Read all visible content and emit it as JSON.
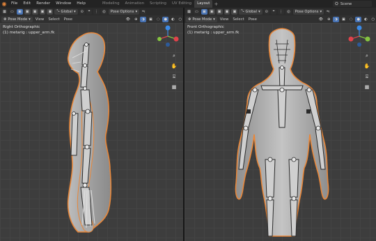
{
  "menu": {
    "items": [
      "File",
      "Edit",
      "Render",
      "Window",
      "Help"
    ],
    "workspaces": [
      "Modeling",
      "Animation",
      "Scripting",
      "UV Editing",
      "Layout"
    ],
    "active_workspace": "Layout",
    "scene_label": "Scene"
  },
  "left_view": {
    "mode": "Pose Mode",
    "menus": [
      "View",
      "Select",
      "Pose"
    ],
    "orientation": "Global",
    "pose_options": "Pose Options",
    "title": "Right Orthographic",
    "subtitle": "(1) metarig : upper_arm.fk"
  },
  "right_view": {
    "mode": "Pose Mode",
    "menus": [
      "View",
      "Select",
      "Pose"
    ],
    "orientation": "Global",
    "pose_options": "Pose Options",
    "title": "Front Orthographic",
    "subtitle": "(1) metarig : upper_arm.fk"
  },
  "gizmo": {
    "z": "Z",
    "y": "Y",
    "x": "X"
  },
  "colors": {
    "accent_blue": "#4772b3",
    "selection_orange": "#e8873a",
    "axis_x": "#e0424a",
    "axis_y": "#86c440",
    "axis_z": "#3b8ae6"
  }
}
